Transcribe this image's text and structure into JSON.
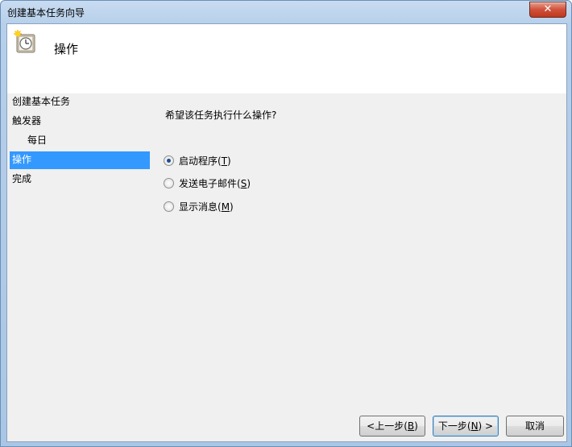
{
  "window": {
    "title": "创建基本任务向导",
    "close_label": "✕"
  },
  "header": {
    "title": "操作",
    "icon": "task-clock-icon"
  },
  "nav": {
    "items": [
      {
        "label": "创建基本任务"
      },
      {
        "label": "触发器"
      },
      {
        "label": "每日"
      },
      {
        "label": "操作"
      },
      {
        "label": "完成"
      }
    ]
  },
  "main": {
    "question": "希望该任务执行什么操作?",
    "options": [
      {
        "label": "启动程序(",
        "mnemonic": "T",
        "suffix": ")",
        "checked": true
      },
      {
        "label": "发送电子邮件(",
        "mnemonic": "S",
        "suffix": ")",
        "checked": false
      },
      {
        "label": "显示消息(",
        "mnemonic": "M",
        "suffix": ")",
        "checked": false
      }
    ]
  },
  "buttons": {
    "back": {
      "label": "<上一步(",
      "mnemonic": "B",
      "suffix": ")"
    },
    "next": {
      "label": "下一步(",
      "mnemonic": "N",
      "suffix": ") >"
    },
    "cancel": {
      "label": "取消"
    }
  }
}
